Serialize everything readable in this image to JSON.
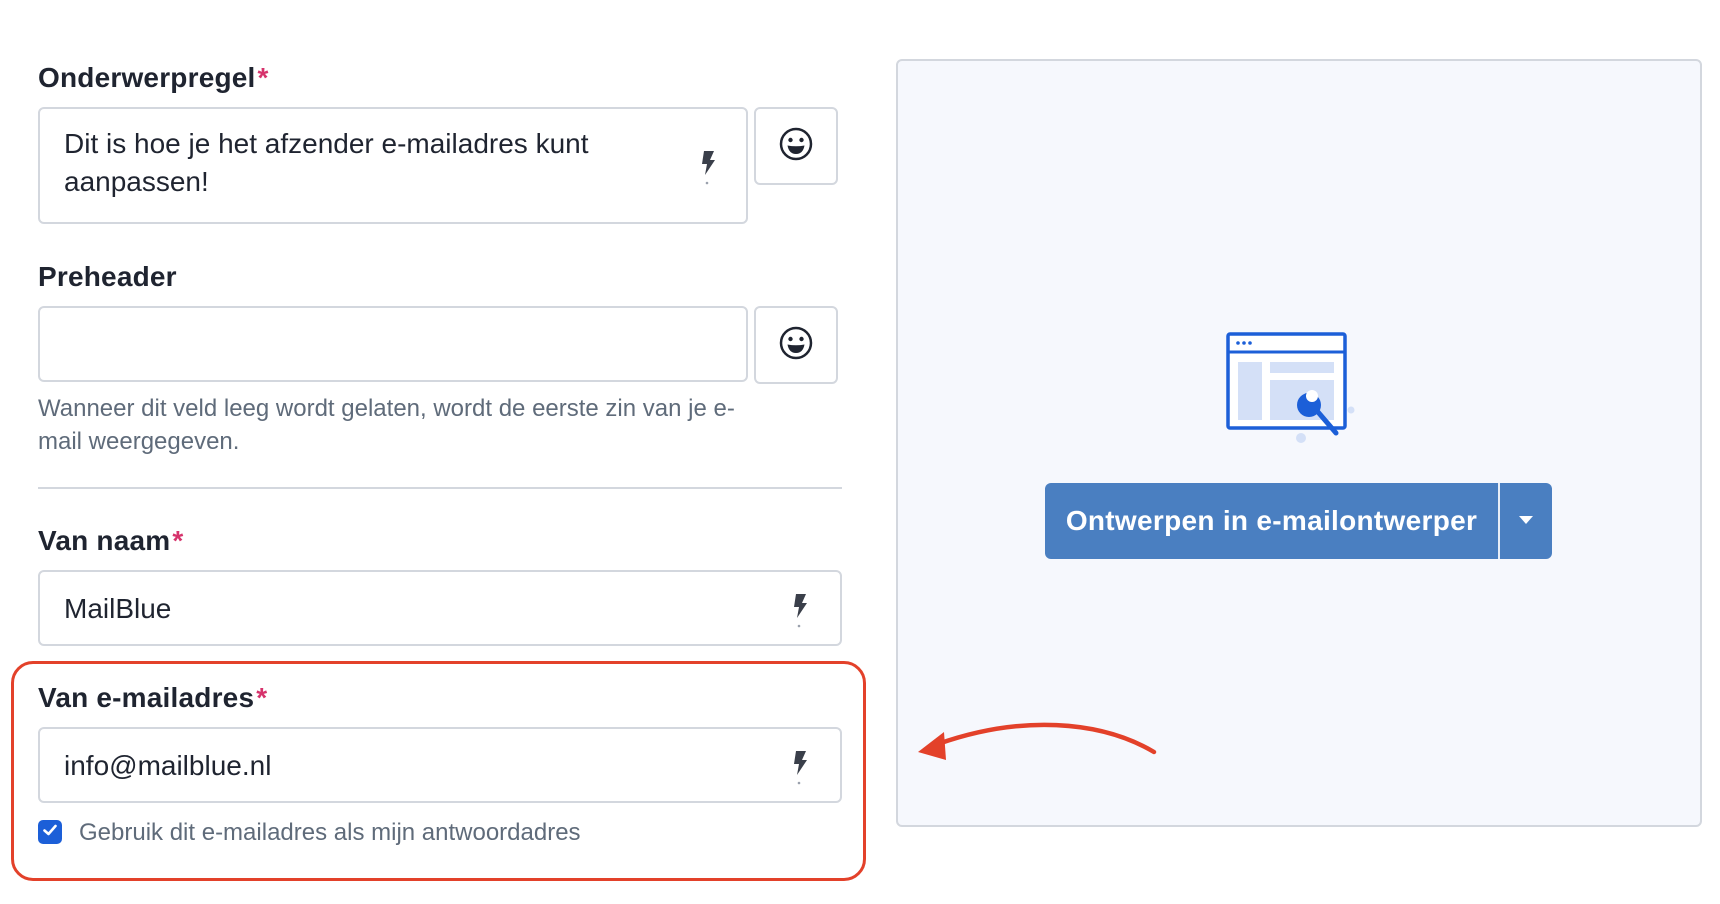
{
  "subject": {
    "label": "Onderwerpregel",
    "required_mark": "*",
    "value_line1": "Dit is hoe je het afzender e-mailadres kunt",
    "value_line2": "aanpassen!"
  },
  "preheader": {
    "label": "Preheader",
    "value": "",
    "help_line1": "Wanneer dit veld leeg wordt gelaten, wordt de eerste zin van je e-",
    "help_line2": "mail weergegeven."
  },
  "from_name": {
    "label": "Van naam",
    "required_mark": "*",
    "value": "MailBlue"
  },
  "from_email": {
    "label": "Van e-mailadres",
    "required_mark": "*",
    "value": "info@mailblue.nl",
    "checkbox_label": "Gebruik dit e-mailadres als mijn antwoordadres",
    "checkbox_checked": true
  },
  "preview": {
    "design_button_label": "Ontwerpen in e-mailontwerper",
    "dropdown_icon": "caret-down-icon",
    "illustration_icon": "email-designer-illustration-icon"
  },
  "icons": {
    "emoji": "smiley-face-icon",
    "personalize": "lightning-bolt-icon"
  },
  "colors": {
    "required": "#d6336c",
    "primary_button": "#4a7fc1",
    "highlight": "#e3412a",
    "checkbox": "#1c5fd8",
    "illustration_blue": "#1c5fd8",
    "illustration_light": "#d4e0f7"
  }
}
